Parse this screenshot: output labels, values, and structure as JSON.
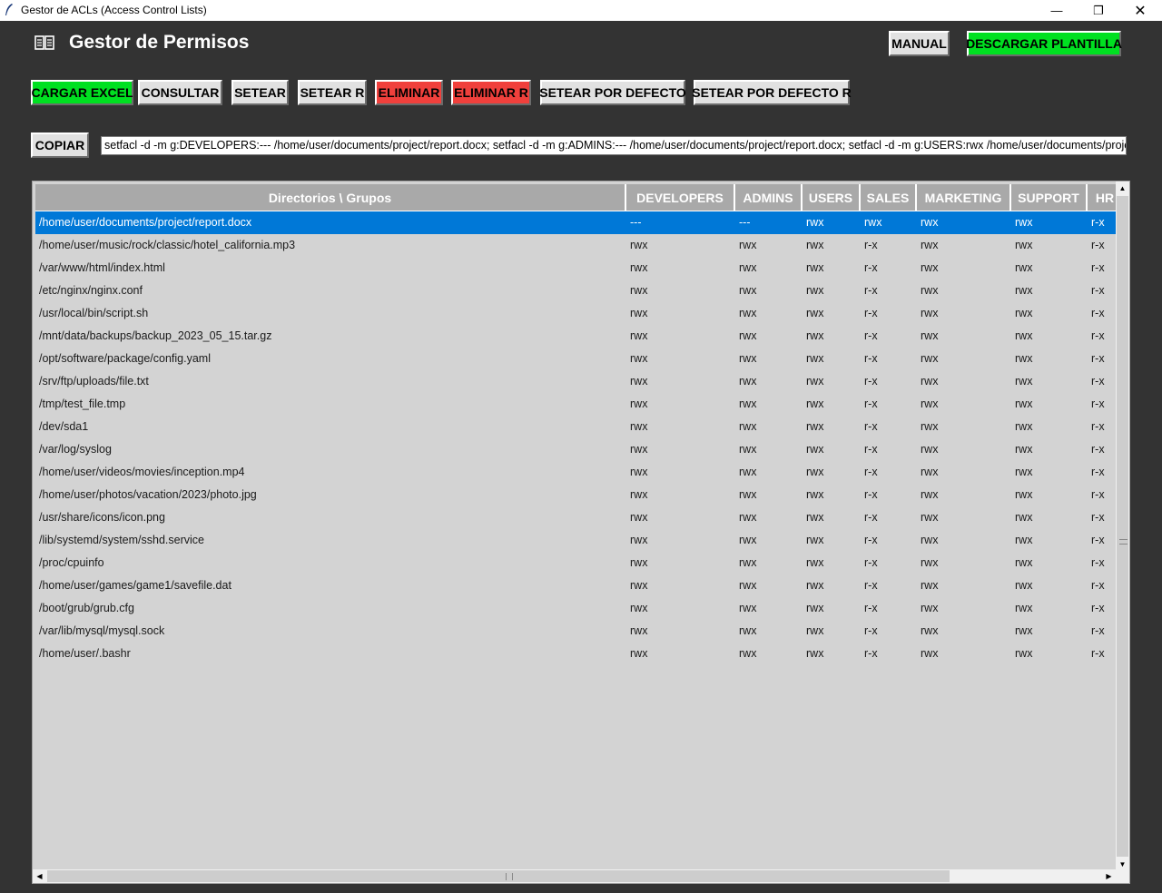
{
  "window": {
    "title": "Gestor de ACLs (Access Control Lists)",
    "minimize_glyph": "—",
    "maximize_glyph": "❐",
    "close_glyph": "✕"
  },
  "header": {
    "title": "Gestor de Permisos",
    "icon": "book-icon",
    "manual_label": "MANUAL",
    "download_label": "DESCARGAR PLANTILLA"
  },
  "toolbar": {
    "load_excel": "CARGAR EXCEL",
    "query": "CONSULTAR",
    "set": "SETEAR",
    "set_r": "SETEAR R",
    "delete": "ELIMINAR",
    "delete_r": "ELIMINAR R",
    "set_default": "SETEAR POR DEFECTO",
    "set_default_r": "SETEAR POR DEFECTO R"
  },
  "copy": {
    "button_label": "COPIAR",
    "command": "setfacl -d -m g:DEVELOPERS:--- /home/user/documents/project/report.docx; setfacl -d -m g:ADMINS:--- /home/user/documents/project/report.docx; setfacl -d -m g:USERS:rwx /home/user/documents/project/report.docx"
  },
  "colors": {
    "accent_green": "#00e021",
    "danger_red": "#f0403c",
    "selection_blue": "#0078d7",
    "background": "#333333"
  },
  "table": {
    "headers": [
      "Directorios \\ Grupos",
      "DEVELOPERS",
      "ADMINS",
      "USERS",
      "SALES",
      "MARKETING",
      "SUPPORT",
      "HR"
    ],
    "selected_row": 0,
    "rows": [
      [
        "/home/user/documents/project/report.docx",
        "---",
        "---",
        "rwx",
        "rwx",
        "rwx",
        "rwx",
        "r-x"
      ],
      [
        "/home/user/music/rock/classic/hotel_california.mp3",
        "rwx",
        "rwx",
        "rwx",
        "r-x",
        "rwx",
        "rwx",
        "r-x"
      ],
      [
        "/var/www/html/index.html",
        "rwx",
        "rwx",
        "rwx",
        "r-x",
        "rwx",
        "rwx",
        "r-x"
      ],
      [
        "/etc/nginx/nginx.conf",
        "rwx",
        "rwx",
        "rwx",
        "r-x",
        "rwx",
        "rwx",
        "r-x"
      ],
      [
        "/usr/local/bin/script.sh",
        "rwx",
        "rwx",
        "rwx",
        "r-x",
        "rwx",
        "rwx",
        "r-x"
      ],
      [
        "/mnt/data/backups/backup_2023_05_15.tar.gz",
        "rwx",
        "rwx",
        "rwx",
        "r-x",
        "rwx",
        "rwx",
        "r-x"
      ],
      [
        "/opt/software/package/config.yaml",
        "rwx",
        "rwx",
        "rwx",
        "r-x",
        "rwx",
        "rwx",
        "r-x"
      ],
      [
        "/srv/ftp/uploads/file.txt",
        "rwx",
        "rwx",
        "rwx",
        "r-x",
        "rwx",
        "rwx",
        "r-x"
      ],
      [
        "/tmp/test_file.tmp",
        "rwx",
        "rwx",
        "rwx",
        "r-x",
        "rwx",
        "rwx",
        "r-x"
      ],
      [
        "/dev/sda1",
        "rwx",
        "rwx",
        "rwx",
        "r-x",
        "rwx",
        "rwx",
        "r-x"
      ],
      [
        "/var/log/syslog",
        "rwx",
        "rwx",
        "rwx",
        "r-x",
        "rwx",
        "rwx",
        "r-x"
      ],
      [
        "/home/user/videos/movies/inception.mp4",
        "rwx",
        "rwx",
        "rwx",
        "r-x",
        "rwx",
        "rwx",
        "r-x"
      ],
      [
        "/home/user/photos/vacation/2023/photo.jpg",
        "rwx",
        "rwx",
        "rwx",
        "r-x",
        "rwx",
        "rwx",
        "r-x"
      ],
      [
        "/usr/share/icons/icon.png",
        "rwx",
        "rwx",
        "rwx",
        "r-x",
        "rwx",
        "rwx",
        "r-x"
      ],
      [
        "/lib/systemd/system/sshd.service",
        "rwx",
        "rwx",
        "rwx",
        "r-x",
        "rwx",
        "rwx",
        "r-x"
      ],
      [
        "/proc/cpuinfo",
        "rwx",
        "rwx",
        "rwx",
        "r-x",
        "rwx",
        "rwx",
        "r-x"
      ],
      [
        "/home/user/games/game1/savefile.dat",
        "rwx",
        "rwx",
        "rwx",
        "r-x",
        "rwx",
        "rwx",
        "r-x"
      ],
      [
        "/boot/grub/grub.cfg",
        "rwx",
        "rwx",
        "rwx",
        "r-x",
        "rwx",
        "rwx",
        "r-x"
      ],
      [
        "/var/lib/mysql/mysql.sock",
        "rwx",
        "rwx",
        "rwx",
        "r-x",
        "rwx",
        "rwx",
        "r-x"
      ],
      [
        "/home/user/.bashr",
        "rwx",
        "rwx",
        "rwx",
        "r-x",
        "rwx",
        "rwx",
        "r-x"
      ]
    ]
  }
}
